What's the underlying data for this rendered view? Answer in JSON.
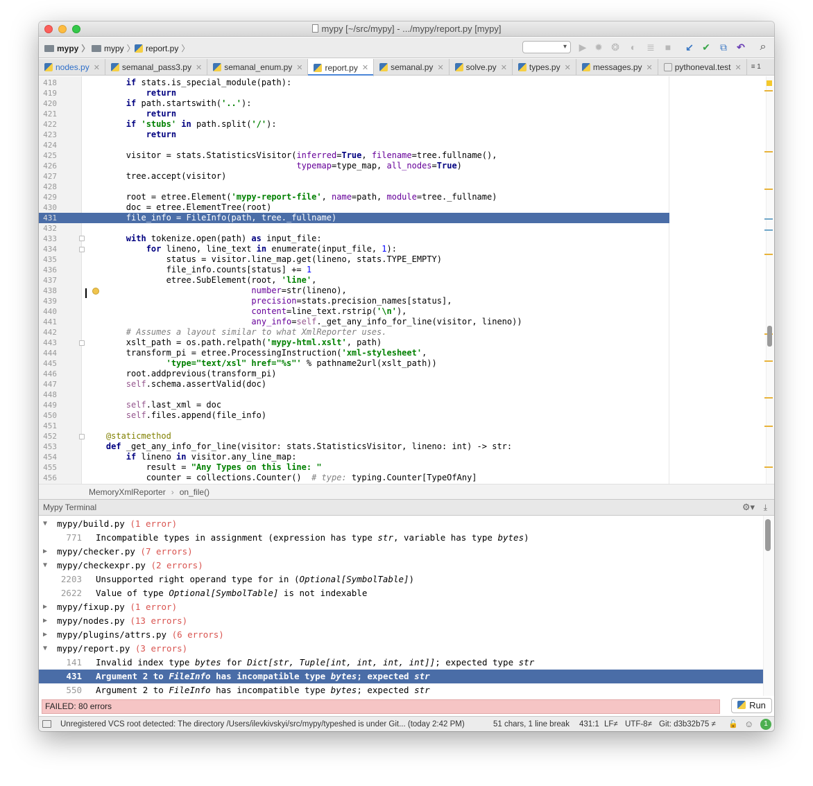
{
  "window": {
    "title": "mypy [~/src/mypy] - .../mypy/report.py [mypy]"
  },
  "navbar": {
    "crumbs": [
      "mypy",
      "mypy",
      "report.py"
    ],
    "config_select": "▾"
  },
  "toolbar": {
    "run_icon": "▶",
    "debug_icon": "✹",
    "coverage_icon": "❂",
    "profile_icon": "◐",
    "concurrency_icon": "≣",
    "stop_icon": "■",
    "vcs_update_icon": "↙",
    "vcs_commit_icon": "✔",
    "vcs_history_icon": "⧉",
    "vcs_revert_icon": "↶",
    "search_icon": "⌕"
  },
  "tabs": [
    {
      "label": "nodes.py",
      "active": false
    },
    {
      "label": "semanal_pass3.py",
      "active": false
    },
    {
      "label": "semanal_enum.py",
      "active": false
    },
    {
      "label": "report.py",
      "active": true
    },
    {
      "label": "semanal.py",
      "active": false
    },
    {
      "label": "solve.py",
      "active": false
    },
    {
      "label": "types.py",
      "active": false
    },
    {
      "label": "messages.py",
      "active": false
    },
    {
      "label": "pythoneval.test",
      "active": false
    }
  ],
  "tab_overflow": "≡ 1",
  "editor": {
    "lines": [
      {
        "n": "418",
        "html": "        <span class='kw'>if</span> stats.is_special_module(path):"
      },
      {
        "n": "419",
        "html": "            <span class='kw'>return</span>"
      },
      {
        "n": "420",
        "html": "        <span class='kw'>if</span> path.startswith(<span class='st'>'..'</span>):"
      },
      {
        "n": "421",
        "html": "            <span class='kw'>return</span>"
      },
      {
        "n": "422",
        "html": "        <span class='kw'>if</span> <span class='st'>'stubs'</span> <span class='kw'>in</span> path.split(<span class='st'>'/'</span>):"
      },
      {
        "n": "423",
        "html": "            <span class='kw'>return</span>"
      },
      {
        "n": "424",
        "html": ""
      },
      {
        "n": "425",
        "html": "        visitor = stats.StatisticsVisitor(<span class='pm'>inferred</span>=<span class='kw'>True</span>, <span class='pm'>filename</span>=tree.fullname(),"
      },
      {
        "n": "426",
        "html": "                                          <span class='pm'>typemap</span>=type_map, <span class='pm'>all_nodes</span>=<span class='kw'>True</span>)"
      },
      {
        "n": "427",
        "html": "        tree.accept(visitor)"
      },
      {
        "n": "428",
        "html": ""
      },
      {
        "n": "429",
        "html": "        root = etree.Element(<span class='st'>'mypy-report-file'</span>, <span class='pm'>name</span>=path, <span class='pm'>module</span>=tree._fullname)"
      },
      {
        "n": "430",
        "html": "        doc = etree.ElementTree(root)"
      },
      {
        "n": "431",
        "html": "        file_info = FileInfo(path, tree._fullname)",
        "hl": true
      },
      {
        "n": "432",
        "html": ""
      },
      {
        "n": "433",
        "html": "        <span class='kw'>with</span> tokenize.open(path) <span class='kw'>as</span> input_file:"
      },
      {
        "n": "434",
        "html": "            <span class='kw'>for</span> lineno, line_text <span class='kw'>in</span> enumerate(input_file, <span class='nm'>1</span>):"
      },
      {
        "n": "435",
        "html": "                status = visitor.line_map.get(lineno, stats.TYPE_EMPTY)"
      },
      {
        "n": "436",
        "html": "                file_info.counts[status] += <span class='nm'>1</span>"
      },
      {
        "n": "437",
        "html": "                etree.SubElement(root, <span class='st'>'line'</span>,"
      },
      {
        "n": "438",
        "html": "                                 <span class='pm'>number</span>=str(lineno),"
      },
      {
        "n": "439",
        "html": "                                 <span class='pm'>precision</span>=stats.precision_names[status],"
      },
      {
        "n": "440",
        "html": "                                 <span class='pm'>content</span>=line_text.rstrip(<span class='st'>'\\n'</span>),"
      },
      {
        "n": "441",
        "html": "                                 <span class='pm'>any_info</span>=<span class='self'>self</span>._get_any_info_for_line(visitor, lineno))"
      },
      {
        "n": "442",
        "html": "        <span class='cm'># Assumes a layout similar to what XmlReporter uses.</span>"
      },
      {
        "n": "443",
        "html": "        xslt_path = os.path.relpath(<span class='st'>'mypy-html.xslt'</span>, path)"
      },
      {
        "n": "444",
        "html": "        transform_pi = etree.ProcessingInstruction(<span class='st'>'xml-stylesheet'</span>,"
      },
      {
        "n": "445",
        "html": "                <span class='st'>'type=\"text/xsl\" href=\"%s\"'</span> % pathname2url(xslt_path))"
      },
      {
        "n": "446",
        "html": "        root.addprevious(transform_pi)"
      },
      {
        "n": "447",
        "html": "        <span class='self'>self</span>.schema.assertValid(doc)"
      },
      {
        "n": "448",
        "html": ""
      },
      {
        "n": "449",
        "html": "        <span class='self'>self</span>.last_xml = doc"
      },
      {
        "n": "450",
        "html": "        <span class='self'>self</span>.files.append(file_info)"
      },
      {
        "n": "451",
        "html": ""
      },
      {
        "n": "452",
        "html": "    <span class='dec'>@staticmethod</span>"
      },
      {
        "n": "453",
        "html": "    <span class='kw'>def</span> _get_any_info_for_line(visitor: stats.StatisticsVisitor, lineno: int) -> str:"
      },
      {
        "n": "454",
        "html": "        <span class='kw'>if</span> lineno <span class='kw'>in</span> visitor.any_line_map:"
      },
      {
        "n": "455",
        "html": "            result = <span class='st'>\"Any Types on this line: \"</span>"
      },
      {
        "n": "456",
        "html": "            counter = collections.Counter()  <span class='cm'># type: </span>typing.Counter[TypeOfAny]"
      }
    ]
  },
  "editor_breadcrumb": {
    "class_name": "MemoryXmlReporter",
    "separator": "›",
    "method_name": "on_file()"
  },
  "terminal": {
    "title": "Mypy Terminal",
    "gear_icon": "⚙▾",
    "hide_icon": "⤓",
    "rows": [
      {
        "kind": "file",
        "expanded": true,
        "file": "mypy/build.py",
        "errors": "(1 error)"
      },
      {
        "kind": "msg",
        "line": "771",
        "html": "Incompatible types in assignment (expression has type <i>str</i>, variable has type <i>bytes</i>)"
      },
      {
        "kind": "file",
        "expanded": false,
        "file": "mypy/checker.py",
        "errors": "(7 errors)"
      },
      {
        "kind": "file",
        "expanded": true,
        "file": "mypy/checkexpr.py",
        "errors": "(2 errors)"
      },
      {
        "kind": "msg",
        "line": "2203",
        "html": "Unsupported right operand type for in (<i>Optional[SymbolTable]</i>)"
      },
      {
        "kind": "msg",
        "line": "2622",
        "html": "Value of type <i>Optional[SymbolTable]</i> is not indexable"
      },
      {
        "kind": "file",
        "expanded": false,
        "file": "mypy/fixup.py",
        "errors": "(1 error)"
      },
      {
        "kind": "file",
        "expanded": false,
        "file": "mypy/nodes.py",
        "errors": "(13 errors)"
      },
      {
        "kind": "file",
        "expanded": false,
        "file": "mypy/plugins/attrs.py",
        "errors": "(6 errors)"
      },
      {
        "kind": "file",
        "expanded": true,
        "file": "mypy/report.py",
        "errors": "(3 errors)"
      },
      {
        "kind": "msg",
        "line": "141",
        "html": "Invalid index type <i>bytes</i> for <i>Dict[str, Tuple[int, int, int, int]]</i>; expected type <i>str</i>"
      },
      {
        "kind": "msg",
        "line": "431",
        "html": "Argument 2 to <i>FileInfo</i> has incompatible type <i>bytes</i>; expected <i>str</i>",
        "selected": true
      },
      {
        "kind": "msg",
        "line": "550",
        "html": "Argument 2 to <i>FileInfo</i> has incompatible type <i>bytes</i>; expected <i>str</i>"
      }
    ],
    "status": "FAILED: 80 errors",
    "run_label": "Run"
  },
  "statusbar": {
    "message": "Unregistered VCS root detected: The directory /Users/ilevkivskyi/src/mypy/typeshed is under Git... (today 2:42 PM)",
    "selection": "51 chars, 1 line break",
    "position": "431:1",
    "line_sep": "LF≠",
    "encoding": "UTF-8≠",
    "git": "Git: d3b32b75 ≠",
    "lock_icon": "ὑ3",
    "inspector_icon": "☺",
    "notifications": "1"
  }
}
